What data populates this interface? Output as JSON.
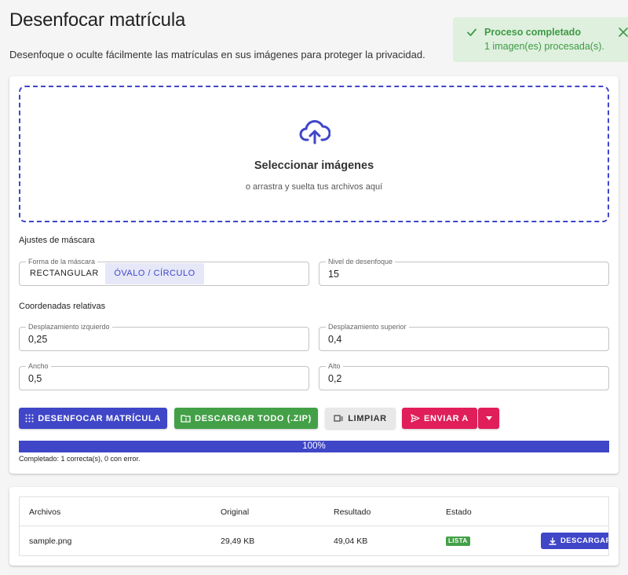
{
  "page": {
    "title": "Desenfocar matrícula",
    "subtitle": "Desenfoque o oculte fácilmente las matrículas en sus imágenes para proteger la privacidad."
  },
  "toast": {
    "title": "Proceso completado",
    "message": "1 imagen(es) procesada(s).",
    "color": "#3d9a44"
  },
  "dropzone": {
    "title": "Seleccionar imágenes",
    "subtitle": "o arrastra y suelta tus archivos aquí",
    "icon": "cloud-upload-icon"
  },
  "mask_settings": {
    "heading": "Ajustes de máscara",
    "shape_label": "Forma de la máscara",
    "shape_options": [
      "RECTANGULAR",
      "ÓVALO / CÍRCULO"
    ],
    "shape_selected": "ÓVALO / CÍRCULO",
    "blur_label": "Nivel de desenfoque",
    "blur_value": "15"
  },
  "coordinates": {
    "heading": "Coordenadas relativas",
    "left_label": "Desplazamiento izquierdo",
    "left_value": "0,25",
    "top_label": "Desplazamiento superior",
    "top_value": "0,4",
    "width_label": "Ancho",
    "width_value": "0,5",
    "height_label": "Alto",
    "height_value": "0,2"
  },
  "actions": {
    "blur": "DESENFOCAR MATRÍCULA",
    "download_all": "DESCARGAR TODO (.ZIP)",
    "clear": "LIMPIAR",
    "send_to": "ENVIAR A"
  },
  "progress": {
    "percent": 100,
    "label": "100%",
    "status": "Completado: 1 correcta(s), 0 con error."
  },
  "files_table": {
    "columns": [
      "Archivos",
      "Original",
      "Resultado",
      "Estado"
    ],
    "rows": [
      {
        "name": "sample.png",
        "original": "29,49 KB",
        "result": "49,04 KB",
        "status": "LISTA",
        "action": "DESCARGAR"
      }
    ]
  },
  "colors": {
    "primary": "#3f46c8",
    "success": "#43a047",
    "danger": "#e01e5a"
  }
}
